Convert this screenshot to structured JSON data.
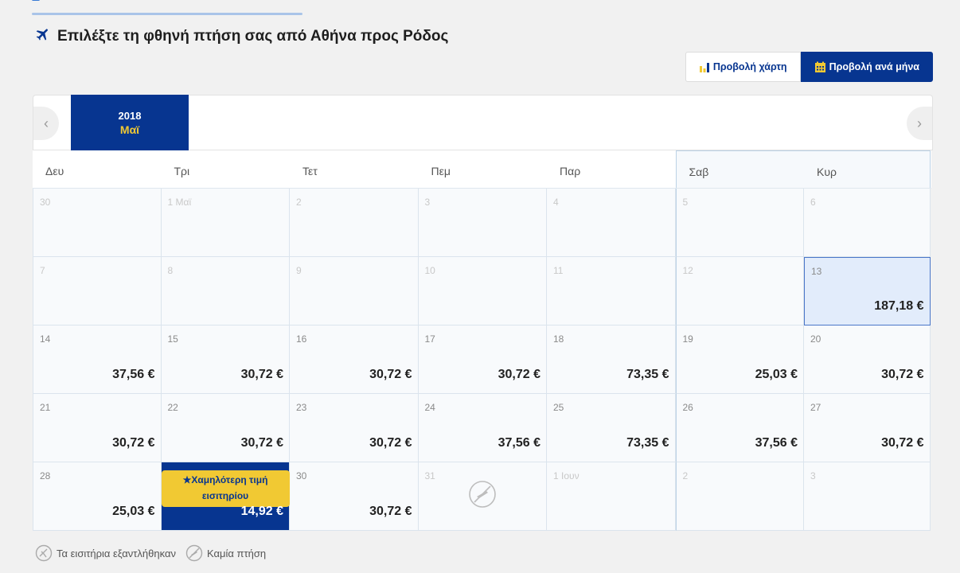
{
  "header": {
    "title": "Επιλέξτε τη φθηνή πτήση σας από Αθήνα προς Ρόδος"
  },
  "view_toggle": {
    "chart_label": "Προβολή χάρτη",
    "month_label": "Προβολή ανά μήνα",
    "active": "month"
  },
  "month_nav": {
    "year": "2018",
    "month": "Μαϊ"
  },
  "weekdays": [
    "Δευ",
    "Τρι",
    "Τετ",
    "Πεμ",
    "Παρ",
    "Σαβ",
    "Κυρ"
  ],
  "days": [
    {
      "day": "30",
      "price": "",
      "state": "disabled"
    },
    {
      "day": "1 Μαϊ",
      "price": "",
      "state": "disabled"
    },
    {
      "day": "2",
      "price": "",
      "state": "disabled"
    },
    {
      "day": "3",
      "price": "",
      "state": "disabled"
    },
    {
      "day": "4",
      "price": "",
      "state": "disabled"
    },
    {
      "day": "5",
      "price": "",
      "state": "disabled"
    },
    {
      "day": "6",
      "price": "",
      "state": "disabled"
    },
    {
      "day": "7",
      "price": "",
      "state": "disabled"
    },
    {
      "day": "8",
      "price": "",
      "state": "disabled"
    },
    {
      "day": "9",
      "price": "",
      "state": "disabled"
    },
    {
      "day": "10",
      "price": "",
      "state": "disabled"
    },
    {
      "day": "11",
      "price": "",
      "state": "disabled"
    },
    {
      "day": "12",
      "price": "",
      "state": "disabled"
    },
    {
      "day": "13",
      "price": "187,18 €",
      "state": "selected"
    },
    {
      "day": "14",
      "price": "37,56 €",
      "state": "available"
    },
    {
      "day": "15",
      "price": "30,72 €",
      "state": "available"
    },
    {
      "day": "16",
      "price": "30,72 €",
      "state": "available"
    },
    {
      "day": "17",
      "price": "30,72 €",
      "state": "available"
    },
    {
      "day": "18",
      "price": "73,35 €",
      "state": "available"
    },
    {
      "day": "19",
      "price": "25,03 €",
      "state": "available"
    },
    {
      "day": "20",
      "price": "30,72 €",
      "state": "available"
    },
    {
      "day": "21",
      "price": "30,72 €",
      "state": "available"
    },
    {
      "day": "22",
      "price": "30,72 €",
      "state": "available"
    },
    {
      "day": "23",
      "price": "30,72 €",
      "state": "available"
    },
    {
      "day": "24",
      "price": "37,56 €",
      "state": "available"
    },
    {
      "day": "25",
      "price": "73,35 €",
      "state": "available"
    },
    {
      "day": "26",
      "price": "37,56 €",
      "state": "available"
    },
    {
      "day": "27",
      "price": "30,72 €",
      "state": "available"
    },
    {
      "day": "28",
      "price": "25,03 €",
      "state": "available"
    },
    {
      "day": "29",
      "price": "14,92 €",
      "state": "cheapest"
    },
    {
      "day": "30",
      "price": "30,72 €",
      "state": "available"
    },
    {
      "day": "31",
      "price": "",
      "state": "no-flight"
    },
    {
      "day": "1 Ιουν",
      "price": "",
      "state": "disabled"
    },
    {
      "day": "2",
      "price": "",
      "state": "disabled"
    },
    {
      "day": "3",
      "price": "",
      "state": "disabled"
    }
  ],
  "cheapest_badge": {
    "line1": "Χαμηλότερη τιμή",
    "line2": "εισιτηρίου"
  },
  "legend": {
    "sold_out": "Τα εισιτήρια εξαντλήθηκαν",
    "no_flight": "Καμία πτήση"
  },
  "colors": {
    "brand_blue": "#073590",
    "brand_yellow": "#f1c933",
    "selected_bg": "#e2ecfb"
  }
}
